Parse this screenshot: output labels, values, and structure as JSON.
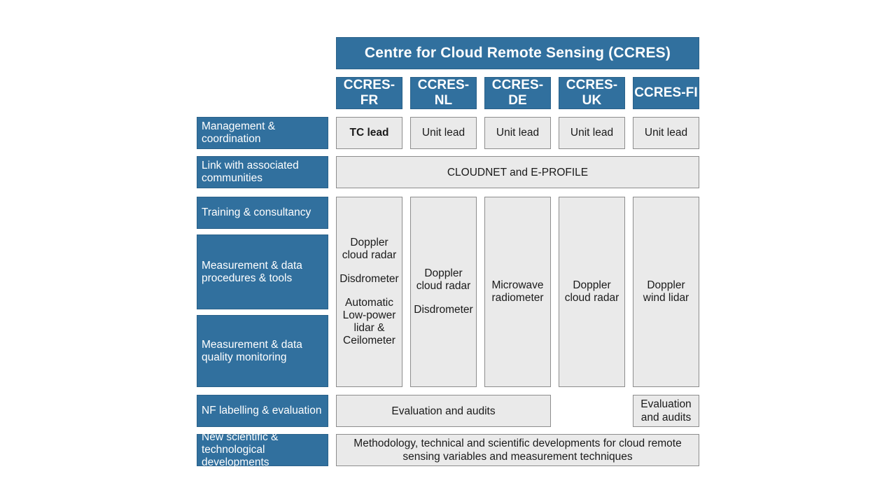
{
  "diagram": {
    "title": "Centre for Cloud Remote Sensing (CCRES)",
    "units": [
      {
        "id": "fr",
        "label": "CCRES-FR"
      },
      {
        "id": "nl",
        "label": "CCRES-NL"
      },
      {
        "id": "de",
        "label": "CCRES-DE"
      },
      {
        "id": "uk",
        "label": "CCRES-UK"
      },
      {
        "id": "fi",
        "label": "CCRES-FI"
      }
    ],
    "row_labels": [
      {
        "id": "management",
        "label": "Management & coordination"
      },
      {
        "id": "link",
        "label": "Link with associated communities"
      },
      {
        "id": "training",
        "label": "Training & consultancy"
      },
      {
        "id": "procedures",
        "label": "Measurement & data procedures & tools"
      },
      {
        "id": "quality",
        "label": "Measurement & data quality monitoring"
      },
      {
        "id": "labelling",
        "label": "NF labelling & evaluation"
      },
      {
        "id": "developments",
        "label": "New scientific & technological developments"
      }
    ],
    "leads": [
      {
        "unit": "fr",
        "label": "TC lead",
        "bold": true
      },
      {
        "unit": "nl",
        "label": "Unit lead",
        "bold": false
      },
      {
        "unit": "de",
        "label": "Unit lead",
        "bold": false
      },
      {
        "unit": "uk",
        "label": "Unit lead",
        "bold": false
      },
      {
        "unit": "fi",
        "label": "Unit lead",
        "bold": false
      }
    ],
    "communities_span": "CLOUDNET and E-PROFILE",
    "instruments": {
      "fr": [
        "Doppler cloud radar",
        "Disdrometer",
        "Automatic Low-power lidar & Ceilometer"
      ],
      "nl": [
        "Doppler cloud radar",
        "Disdrometer"
      ],
      "de": [
        "Microwave radiometer"
      ],
      "uk": [
        "Doppler cloud radar"
      ],
      "fi": [
        "Doppler wind lidar"
      ]
    },
    "evaluation_span": "Evaluation and audits",
    "evaluation_fi": "Evaluation and audits",
    "developments_span": "Methodology, technical and scientific developments for cloud remote sensing variables and measurement techniques",
    "colors": {
      "blue": "#31709e",
      "blue_border": "#2a6189",
      "grey_fill": "#eaeaea",
      "grey_border": "#8d8d8d",
      "text_dark": "#1a1a1a",
      "text_light": "#ffffff"
    }
  }
}
